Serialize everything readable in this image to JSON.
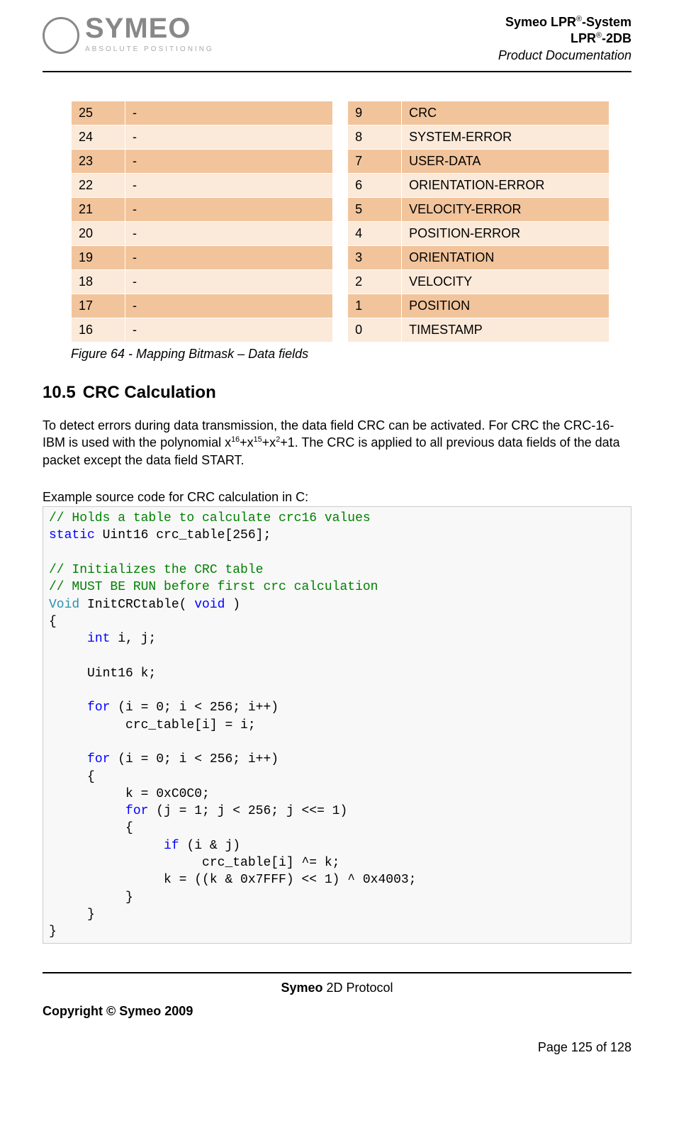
{
  "header": {
    "logo_text": "SYMEO",
    "logo_tagline": "ABSOLUTE POSITIONING",
    "line1_a": "Symeo LPR",
    "line1_b": "-System",
    "line2_a": "LPR",
    "line2_b": "-2DB",
    "line3": "Product Documentation",
    "reg": "®"
  },
  "left_table": [
    {
      "bit": "25",
      "name": "-"
    },
    {
      "bit": "24",
      "name": "-"
    },
    {
      "bit": "23",
      "name": "-"
    },
    {
      "bit": "22",
      "name": "-"
    },
    {
      "bit": "21",
      "name": "-"
    },
    {
      "bit": "20",
      "name": "-"
    },
    {
      "bit": "19",
      "name": "-"
    },
    {
      "bit": "18",
      "name": "-"
    },
    {
      "bit": "17",
      "name": "-"
    },
    {
      "bit": "16",
      "name": "-"
    }
  ],
  "right_table": [
    {
      "bit": "9",
      "name": "CRC"
    },
    {
      "bit": "8",
      "name": "SYSTEM-ERROR"
    },
    {
      "bit": "7",
      "name": "USER-DATA"
    },
    {
      "bit": "6",
      "name": "ORIENTATION-ERROR"
    },
    {
      "bit": "5",
      "name": "VELOCITY-ERROR"
    },
    {
      "bit": "4",
      "name": "POSITION-ERROR"
    },
    {
      "bit": "3",
      "name": "ORIENTATION"
    },
    {
      "bit": "2",
      "name": "VELOCITY"
    },
    {
      "bit": "1",
      "name": "POSITION"
    },
    {
      "bit": "0",
      "name": "TIMESTAMP"
    }
  ],
  "figure_caption": "Figure 64 - Mapping Bitmask – Data fields",
  "section": {
    "number": "10.5",
    "title": "CRC Calculation"
  },
  "paragraph": {
    "pre": "To detect errors during data transmission, the data field CRC can be activated. For CRC the CRC-16-IBM is used with the polynomial x",
    "e1": "16",
    "p1": "+x",
    "e2": "15",
    "p2": "+x",
    "e3": "2",
    "post": "+1. The CRC is applied to all previous data fields of the data packet except the data field START."
  },
  "example_label": "Example source code for CRC calculation in C:",
  "code": {
    "c1": "// Holds a table to calculate crc16 values",
    "l2a": "static",
    "l2b": " Uint16 crc_table[256];",
    "c3": "// Initializes the CRC table",
    "c4": "// MUST BE RUN before first crc calculation",
    "l5a": "Void",
    "l5b": " InitCRCtable( ",
    "l5c": "void",
    "l5d": " )",
    "l6": "{",
    "l7a": "int",
    "l7b": " i, j;",
    "l8": "     Uint16 k;",
    "l9a": "for",
    "l9b": " (i = 0; i < 256; i++)",
    "l10": "          crc_table[i] = i;",
    "l11a": "for",
    "l11b": " (i = 0; i < 256; i++)",
    "l12": "     {",
    "l13": "          k = 0xC0C0;",
    "l14a": "for",
    "l14b": " (j = 1; j < 256; j <<= 1)",
    "l15": "          {",
    "l16a": "if",
    "l16b": " (i & j)",
    "l17": "                    crc_table[i] ^= k;",
    "l18": "               k = ((k & 0x7FFF) << 1) ^ 0x4003;",
    "l19": "          }",
    "l20": "     }",
    "l21": "}"
  },
  "footer": {
    "protocol_a": "Symeo",
    "protocol_b": " 2D Protocol",
    "copyright": "Copyright © Symeo 2009",
    "page": "Page 125 of 128"
  }
}
